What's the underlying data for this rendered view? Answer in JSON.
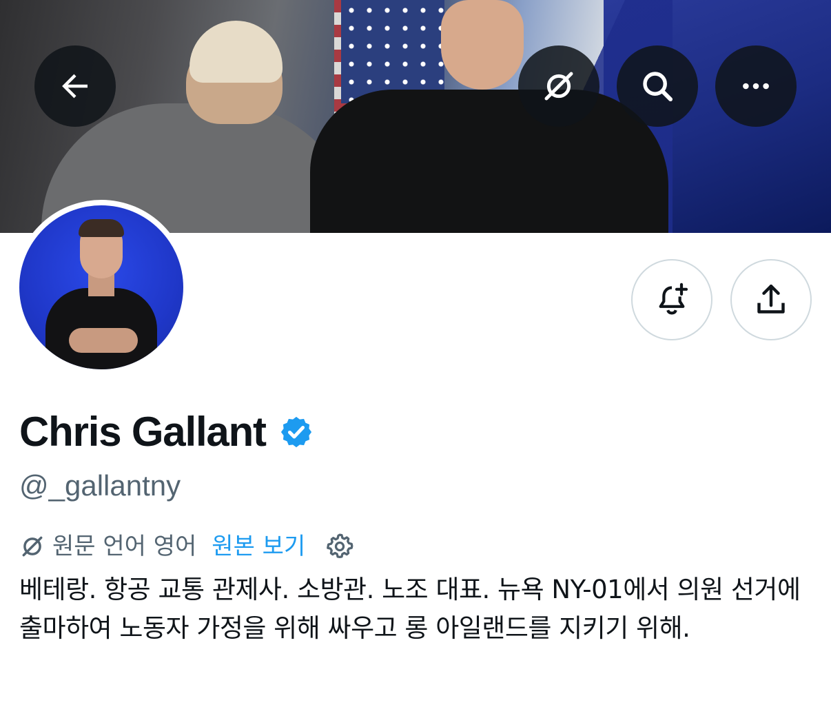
{
  "header": {
    "back_icon": "arrow-left-icon",
    "translate_icon": "translate-icon",
    "search_icon": "search-icon",
    "more_icon": "more-horizontal-icon"
  },
  "actions": {
    "notify_icon": "bell-plus-icon",
    "share_icon": "share-icon"
  },
  "profile": {
    "display_name": "Chris Gallant",
    "verified": true,
    "handle": "@_gallantny"
  },
  "translation": {
    "original_text": "원문 언어 영어",
    "view_original": "원본 보기"
  },
  "bio": "베테랑. 항공 교통 관제사. 소방관. 노조 대표. 뉴욕 NY-01에서 의원 선거에 출마하여 노동자 가정을 위해 싸우고 롱 아일랜드를 지키기 위해.",
  "colors": {
    "accent": "#1d9bf0",
    "secondary_text": "#536471",
    "primary_text": "#0f1419"
  }
}
